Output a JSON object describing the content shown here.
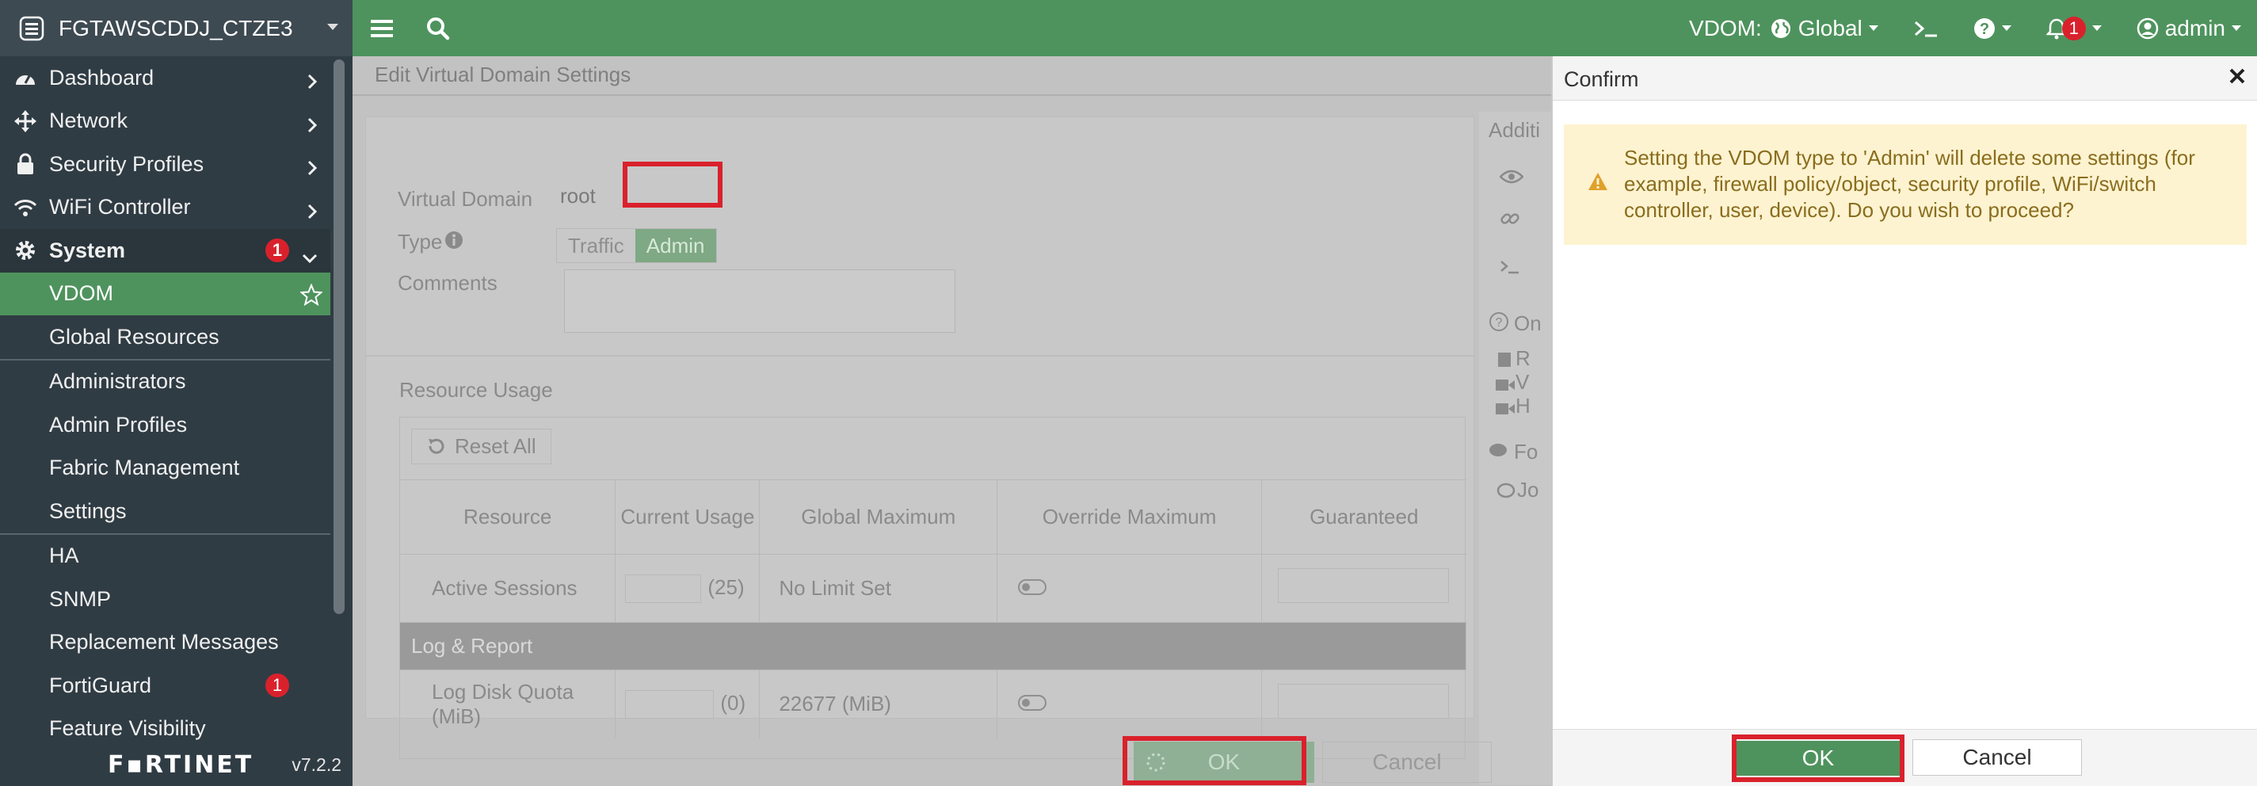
{
  "topbar": {
    "device_name": "FGTAWSCDDJ_CTZE3",
    "vdom_label": "VDOM:",
    "vdom_value": "Global",
    "notification_count": "1",
    "user": "admin"
  },
  "sidebar": {
    "items": [
      {
        "label": "Dashboard"
      },
      {
        "label": "Network"
      },
      {
        "label": "Security Profiles"
      },
      {
        "label": "WiFi Controller"
      },
      {
        "label": "System",
        "badge": "1"
      },
      {
        "label": "VDOM"
      },
      {
        "label": "Global Resources"
      },
      {
        "label": "Administrators"
      },
      {
        "label": "Admin Profiles"
      },
      {
        "label": "Fabric Management"
      },
      {
        "label": "Settings"
      },
      {
        "label": "HA"
      },
      {
        "label": "SNMP"
      },
      {
        "label": "Replacement Messages"
      },
      {
        "label": "FortiGuard",
        "badge": "1"
      },
      {
        "label": "Feature Visibility"
      }
    ],
    "logo": "F▪RTINET",
    "version": "v7.2.2"
  },
  "main": {
    "page_title": "Edit Virtual Domain Settings",
    "virtual_domain_label": "Virtual Domain",
    "virtual_domain_value": "root",
    "type_label": "Type",
    "type_options": [
      "Traffic",
      "Admin"
    ],
    "comments_label": "Comments",
    "resource_usage_title": "Resource Usage",
    "reset_all": "Reset All",
    "columns": [
      "Resource",
      "Current Usage",
      "Global Maximum",
      "Override Maximum",
      "Guaranteed"
    ],
    "rows": [
      {
        "resource": "Active Sessions",
        "current": "(25)",
        "global_max": "No Limit Set"
      }
    ],
    "group_label": "Log & Report",
    "rows2": [
      {
        "resource": "Log Disk Quota (MiB)",
        "current": "(0)",
        "global_max": "22677 (MiB)"
      }
    ],
    "right_panel_partial": [
      "Additi",
      "On",
      "R",
      "V",
      "H",
      "Fo",
      "Jo"
    ],
    "ok_label": "OK",
    "cancel_label": "Cancel"
  },
  "dialog": {
    "title": "Confirm",
    "message": "Setting the VDOM type to 'Admin' will delete some settings (for example, firewall policy/object, security profile, WiFi/switch controller, user, device). Do you wish to proceed?",
    "ok_label": "OK",
    "cancel_label": "Cancel"
  },
  "colors": {
    "brand_green": "#4e935d",
    "sidebar_bg": "#303c44",
    "highlight_red": "#d9212c",
    "warning_bg": "#fdf3d0"
  }
}
